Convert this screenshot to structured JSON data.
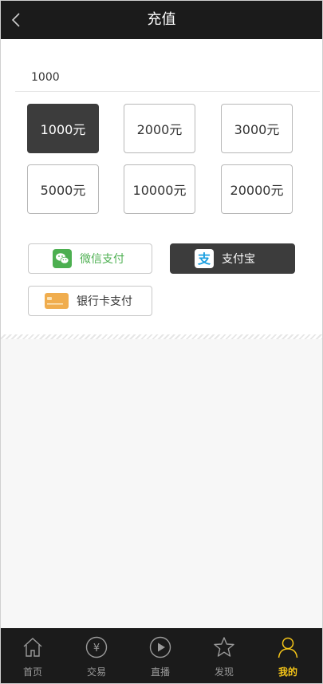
{
  "header": {
    "title": "充值",
    "back_icon": "chevron-left-icon"
  },
  "amount": {
    "value": "1000"
  },
  "options": [
    {
      "label": "1000元",
      "selected": true
    },
    {
      "label": "2000元",
      "selected": false
    },
    {
      "label": "3000元",
      "selected": false
    },
    {
      "label": "5000元",
      "selected": false
    },
    {
      "label": "10000元",
      "selected": false
    },
    {
      "label": "20000元",
      "selected": false
    }
  ],
  "payments": [
    {
      "label": "微信支付",
      "icon": "wechat-icon",
      "selected": false,
      "text_color": "#4caf50"
    },
    {
      "label": "支付宝",
      "icon": "alipay-icon",
      "selected": true
    },
    {
      "label": "银行卡支付",
      "icon": "bank-card-icon",
      "selected": false
    }
  ],
  "tabbar": {
    "items": [
      {
        "label": "首页",
        "icon": "home-icon",
        "active": false
      },
      {
        "label": "交易",
        "icon": "yen-icon",
        "active": false
      },
      {
        "label": "直播",
        "icon": "play-icon",
        "active": false
      },
      {
        "label": "发现",
        "icon": "star-icon",
        "active": false
      },
      {
        "label": "我的",
        "icon": "user-icon",
        "active": true
      }
    ]
  },
  "colors": {
    "header_bg": "#1b1b1b",
    "selected_bg": "#3c3c3c",
    "active_tab": "#f5c518",
    "wechat": "#4caf50",
    "alipay": "#1a9fe0",
    "bank_card": "#f0ad4e"
  }
}
